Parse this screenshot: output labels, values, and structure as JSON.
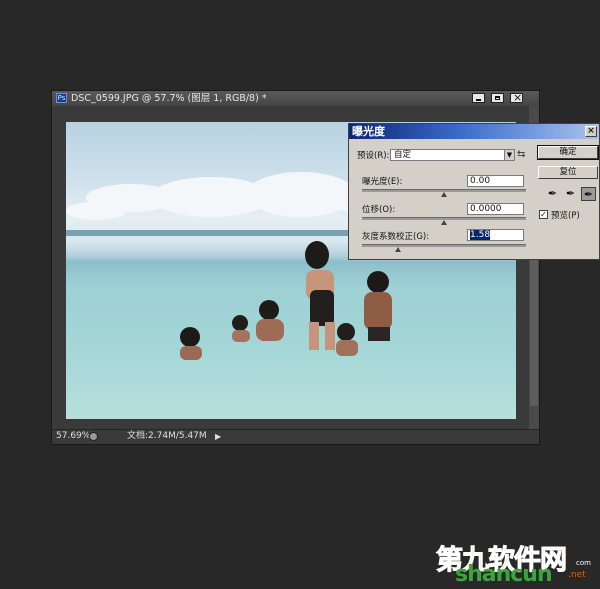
{
  "document": {
    "app_icon": "Ps",
    "title": "DSC_0599.JPG @ 57.7% (图层 1, RGB/8) *",
    "zoom": "57.69%",
    "doc_size": "文档:2.74M/5.47M"
  },
  "dialog": {
    "title": "曝光度",
    "preset_label": "预设(R):",
    "preset_value": "自定",
    "exposure_label": "曝光度(E):",
    "exposure_value": "0.00",
    "exposure_slider_level": 0.5,
    "offset_label": "位移(O):",
    "offset_value": "0.0000",
    "offset_slider_level": 0.5,
    "gamma_label": "灰度系数校正(G):",
    "gamma_value": "1.58",
    "gamma_slider_level": 0.22,
    "ok_label": "确定",
    "reset_label": "复位",
    "preview_label": "预览(P)",
    "preview_checked": true,
    "icons": [
      "black-eyedropper-icon",
      "gray-eyedropper-icon",
      "white-eyedropper-icon"
    ]
  },
  "watermark": {
    "cn": "第九软件网",
    "en": "shancun",
    "net": ".net",
    "tld": "com"
  }
}
